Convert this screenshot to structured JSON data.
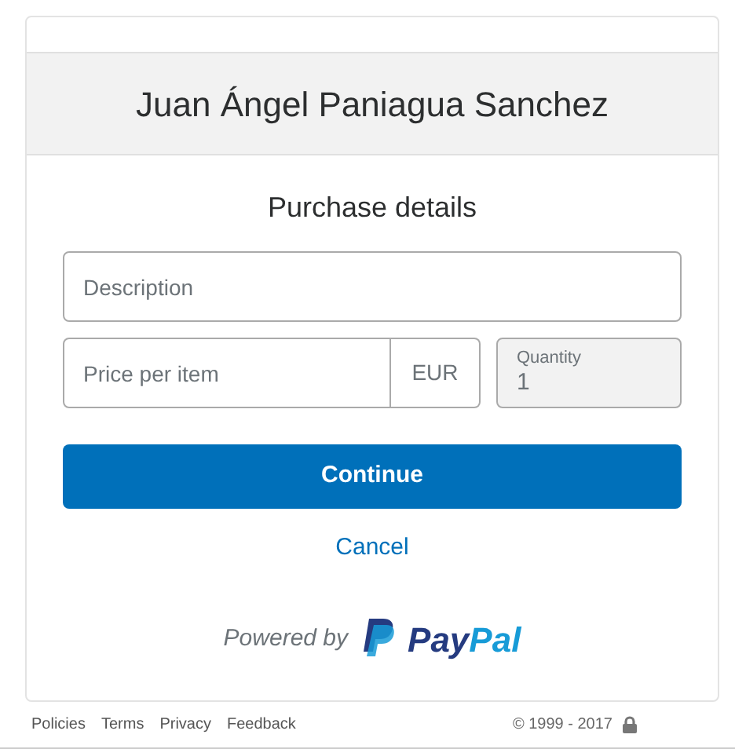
{
  "merchant_name": "Juan Ángel Paniagua Sanchez",
  "heading": "Purchase details",
  "description_field": {
    "placeholder": "Description"
  },
  "price_field": {
    "placeholder": "Price per item",
    "currency": "EUR"
  },
  "quantity_field": {
    "label": "Quantity",
    "value": "1",
    "disabled": true
  },
  "continue_button": "Continue",
  "cancel_link": "Cancel",
  "powered_by": "Powered by",
  "logo_parts": [
    {
      "text": "Pay",
      "color": "#253b80"
    },
    {
      "text": "Pal",
      "color": "#179bd7"
    }
  ],
  "footer_links": [
    "Policies",
    "Terms",
    "Privacy",
    "Feedback"
  ],
  "copyright": "© 1999 - 2017"
}
